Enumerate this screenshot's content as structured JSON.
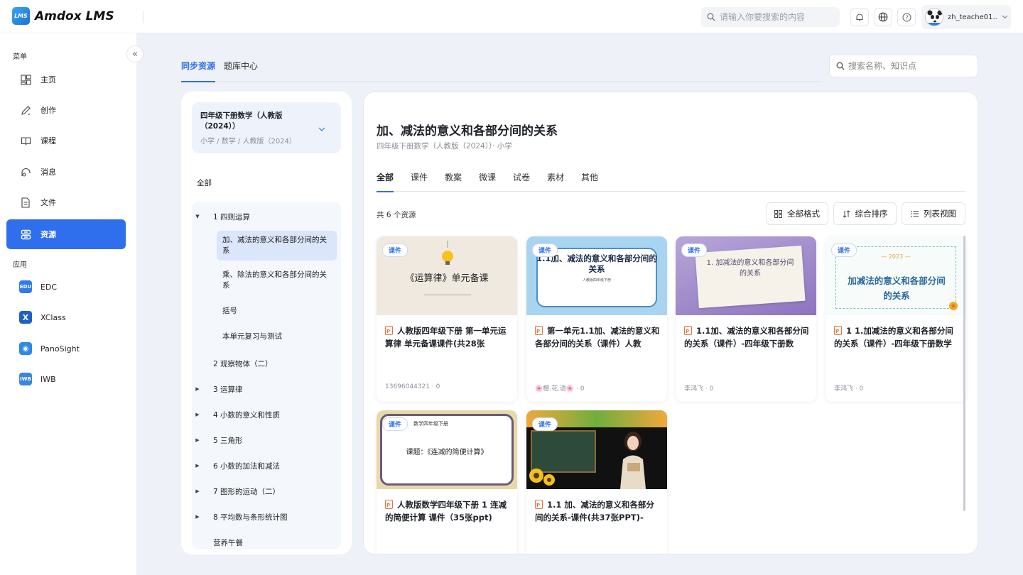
{
  "app": {
    "logo_badge": "LMS",
    "name": "Amdox LMS"
  },
  "top": {
    "search_placeholder": "请输入你要搜索的内容",
    "user_name": "zh_teache01..."
  },
  "sidebar": {
    "section_menu": "菜单",
    "items": [
      {
        "label": "主页",
        "icon": "dashboard-icon"
      },
      {
        "label": "创作",
        "icon": "pen-icon"
      },
      {
        "label": "课程",
        "icon": "book-icon"
      },
      {
        "label": "消息",
        "icon": "message-icon"
      },
      {
        "label": "文件",
        "icon": "file-icon"
      },
      {
        "label": "资源",
        "icon": "resource-icon",
        "active": true
      }
    ],
    "section_apps": "应用",
    "apps": [
      {
        "label": "EDC",
        "badge": "EDU",
        "color": "#2f7be8"
      },
      {
        "label": "XClass",
        "badge": "X",
        "color": "#1e5fc9"
      },
      {
        "label": "PanoSight",
        "badge": "◉",
        "color": "#2b8ae6"
      },
      {
        "label": "IWB",
        "badge": "IWB",
        "color": "#3a86e0"
      }
    ]
  },
  "main_tabs": [
    {
      "label": "同步资源",
      "active": true
    },
    {
      "label": "题库中心",
      "active": false
    }
  ],
  "right_search_placeholder": "搜索名称、知识点",
  "tree": {
    "book_title": "四年级下册数学（人教版（2024））",
    "book_sub": "小学 / 数学 / 人教版（2024）",
    "all_label": "全部",
    "chapter1": "1 四则运算",
    "sub_items": [
      "加、减法的意义和各部分间的关系",
      "乘、除法的意义和各部分间的关系",
      "括号",
      "本单元复习与测试"
    ],
    "chapters": [
      "2 观察物体（二）",
      "3 运算律",
      "4 小数的意义和性质",
      "5 三角形",
      "6 小数的加法和减法",
      "7 图形的运动（二）",
      "8 平均数与条形统计图",
      "营养午餐"
    ]
  },
  "content": {
    "title": "加、减法的意义和各部分间的关系",
    "subtitle": "四年级下册数学（人教版（2024））· 小学",
    "tabs": [
      "全部",
      "课件",
      "教案",
      "微课",
      "试卷",
      "素材",
      "其他"
    ],
    "count": "共 6 个资源",
    "tools": [
      "全部格式",
      "综合排序",
      "列表视图"
    ],
    "badge": "课件",
    "cards": [
      {
        "thumb_text": "《运算律》单元备课",
        "title": "人教版四年级下册 第一单元运算律 单元备课课件(共28张",
        "meta": "13696044321 · 0"
      },
      {
        "thumb_text": "1.1加、减法的意义和各部分间的关系",
        "thumb_sub": "人教版四年级下册",
        "title": "第一单元1.1加、减法的意义和各部分间的关系（课件）人教",
        "meta": "🌸樱.花.语🌸 · 0"
      },
      {
        "thumb_text": "1. 加减法的意义和各部分间的关系",
        "title": "1.1加、减法的意义和各部分间的关系（课件）-四年级下册数",
        "meta": "李鸿飞 · 0"
      },
      {
        "thumb_text": "加减法的意义和各部分间的关系",
        "thumb_sub": "— 2023 —",
        "title": "1 1.加减法的意义和各部分间的关系（课件）-四年级下册数学",
        "meta": "李鸿飞 · 0"
      },
      {
        "thumb_text": "课题：《连减的简便计算》",
        "thumb_sub": "数学四年级下册",
        "title": "人教版数学四年级下册 1 连减的简便计算 课件（35张ppt)",
        "meta": ""
      },
      {
        "thumb_text": "",
        "title": "1.1 加、减法的意义和各部分间的关系-课件(共37张PPT)-",
        "meta": ""
      }
    ]
  }
}
